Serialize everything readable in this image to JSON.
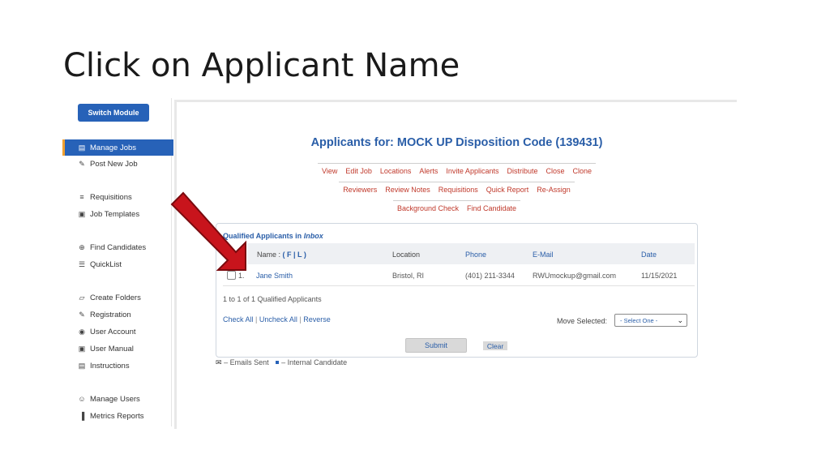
{
  "slide": {
    "title": "Click on Applicant Name"
  },
  "sidebar": {
    "switch_module": "Switch Module",
    "items": [
      {
        "label": "Manage Jobs",
        "icon": "briefcase-icon",
        "glyph": "▤",
        "active": true
      },
      {
        "label": "Post New Job",
        "icon": "edit-icon",
        "glyph": "✎"
      },
      {
        "label": "Requisitions",
        "icon": "list-icon",
        "glyph": "≡"
      },
      {
        "label": "Job Templates",
        "icon": "clipboard-icon",
        "glyph": "▣"
      },
      {
        "label": "Find Candidates",
        "icon": "search-icon",
        "glyph": "⊕"
      },
      {
        "label": "QuickList",
        "icon": "checklist-icon",
        "glyph": "☰"
      },
      {
        "label": "Create Folders",
        "icon": "folder-icon",
        "glyph": "▱"
      },
      {
        "label": "Registration",
        "icon": "register-icon",
        "glyph": "✎"
      },
      {
        "label": "User Account",
        "icon": "user-circle-icon",
        "glyph": "◉"
      },
      {
        "label": "User Manual",
        "icon": "book-icon",
        "glyph": "▣"
      },
      {
        "label": "Instructions",
        "icon": "document-icon",
        "glyph": "▤"
      },
      {
        "label": "Manage Users",
        "icon": "users-icon",
        "glyph": "☺"
      },
      {
        "label": "Metrics Reports",
        "icon": "chart-icon",
        "glyph": "▐"
      }
    ]
  },
  "main": {
    "title": "Applicants for: MOCK UP Disposition Code (139431)",
    "links_row1": [
      "View",
      "Edit Job",
      "Locations",
      "Alerts",
      "Invite Applicants",
      "Distribute",
      "Close",
      "Clone"
    ],
    "links_row2": [
      "Reviewers",
      "Review Notes",
      "Requisitions",
      "Quick Report",
      "Re-Assign"
    ],
    "links_row3": [
      "Background Check",
      "Find Candidate"
    ],
    "card": {
      "heading": "Qualified Applicants in",
      "heading_folder": "Inbox",
      "columns": {
        "name": "Name :",
        "name_sort": "( F | L )",
        "location": "Location",
        "phone": "Phone",
        "email": "E-Mail",
        "date": "Date"
      },
      "rows": [
        {
          "index": "1.",
          "name": "Jane Smith",
          "location": "Bristol, RI",
          "phone": "(401) 211-3344",
          "email": "RWUmockup@gmail.com",
          "date": "11/15/2021"
        }
      ],
      "count_text": "1 to 1 of 1 Qualified Applicants",
      "check_all": "Check All",
      "uncheck_all": "Uncheck All",
      "reverse": "Reverse",
      "move_label": "Move Selected:",
      "move_select_value": "- Select One -",
      "submit": "Submit",
      "clear": "Clear"
    },
    "legend": {
      "emails_sent": "– Emails Sent",
      "internal": "– Internal Candidate"
    }
  },
  "colors": {
    "accent": "#2762b8",
    "link_red": "#c0392b",
    "arrow": "#c8141c"
  }
}
